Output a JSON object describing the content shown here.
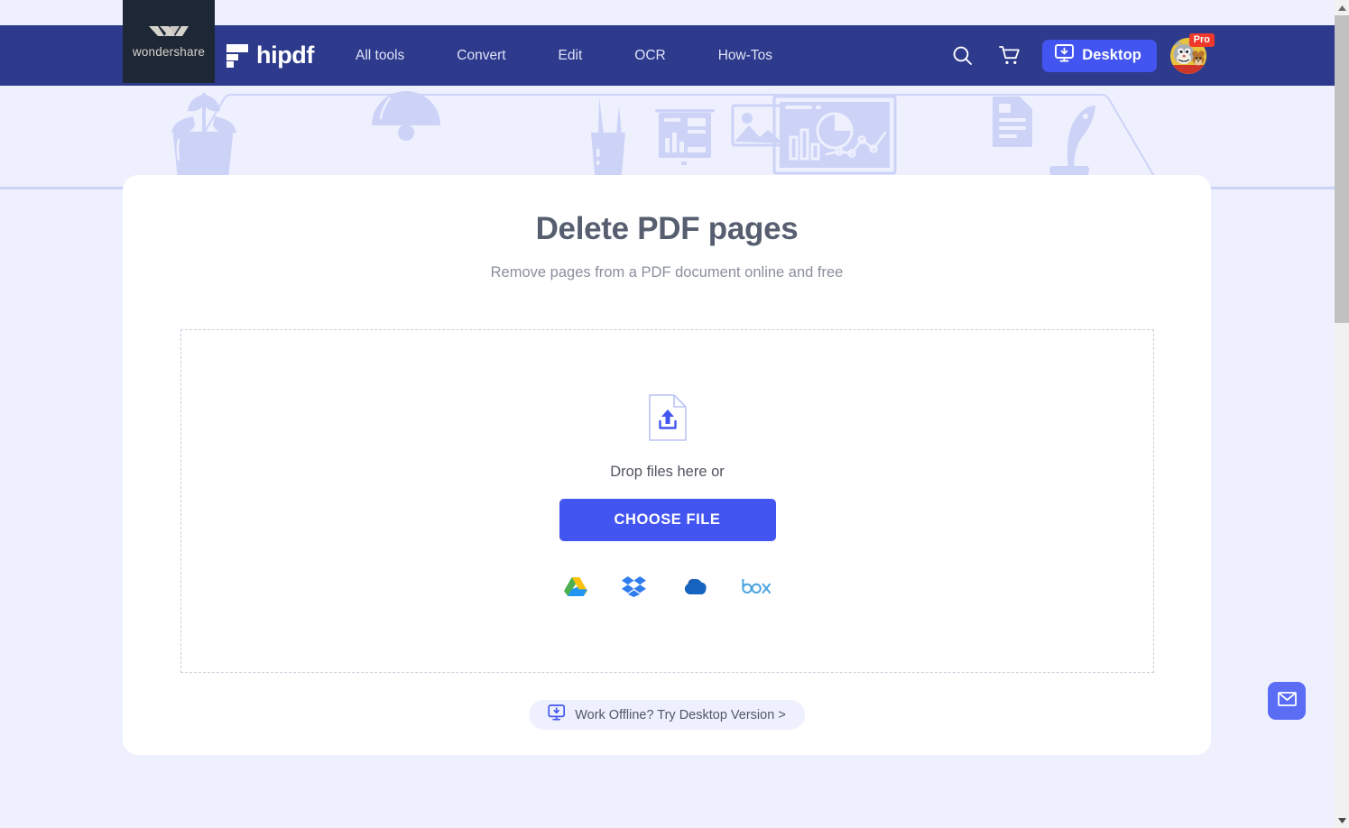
{
  "brand": {
    "wondershare_label": "wondershare",
    "product_name": "hipdf",
    "wondershare_icon": "wondershare-logo-icon",
    "hipdf_icon": "hipdf-logo-icon"
  },
  "nav": {
    "links": [
      {
        "label": "All tools"
      },
      {
        "label": "Convert"
      },
      {
        "label": "Edit"
      },
      {
        "label": "OCR"
      },
      {
        "label": "How-Tos"
      }
    ],
    "search_icon": "search-icon",
    "cart_icon": "shopping-cart-icon",
    "desktop_button": {
      "label": "Desktop",
      "icon": "monitor-download-icon"
    },
    "avatar": {
      "name": "user-avatar",
      "badge": "Pro"
    }
  },
  "tool": {
    "title": "Delete PDF pages",
    "subtitle": "Remove pages from a PDF document online and free"
  },
  "dropzone": {
    "upload_icon": "file-upload-icon",
    "drop_text": "Drop files here or",
    "choose_file_label": "CHOOSE FILE",
    "cloud_sources": [
      {
        "name": "google-drive-icon",
        "label": "Google Drive"
      },
      {
        "name": "dropbox-icon",
        "label": "Dropbox"
      },
      {
        "name": "onedrive-icon",
        "label": "OneDrive"
      },
      {
        "name": "box-icon",
        "label": "Box"
      }
    ]
  },
  "offline": {
    "label": "Work Offline? Try Desktop Version >",
    "icon": "monitor-download-icon"
  },
  "floating": {
    "mail_icon": "envelope-icon"
  },
  "colors": {
    "nav_bg": "#2e3a8c",
    "wondershare_panel": "#1e2735",
    "accent": "#4355f0",
    "page_bg": "#eef0fe",
    "card_bg": "#ffffff",
    "title_text": "#565e6f",
    "subtitle_text": "#8a8f9e",
    "badge_red": "#f0392b",
    "illustration": "#ccd3f7"
  },
  "scrollbar": {
    "up_arrow": "scroll-up-arrow",
    "down_arrow": "scroll-down-arrow"
  }
}
